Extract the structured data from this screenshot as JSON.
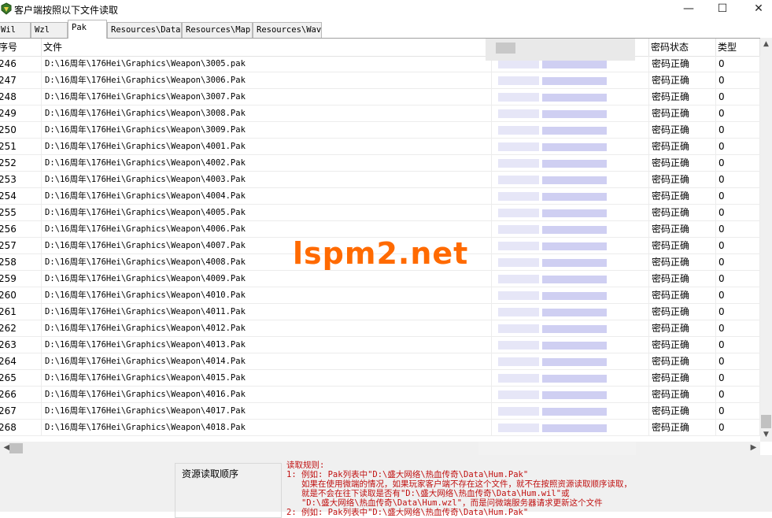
{
  "window": {
    "title": "客户端按照以下文件读取",
    "controls": {
      "minimize": "—",
      "maximize": "☐",
      "close": "✕"
    }
  },
  "tabs": [
    {
      "label": "Wil",
      "active": false
    },
    {
      "label": "Wzl",
      "active": false
    },
    {
      "label": "Pak",
      "active": true
    },
    {
      "label": "Resources\\Data",
      "active": false
    },
    {
      "label": "Resources\\Map",
      "active": false
    },
    {
      "label": "Resources\\Wav",
      "active": false
    }
  ],
  "list": {
    "columns": {
      "index": "序号",
      "file": "文件",
      "status": "密码状态",
      "type": "类型"
    },
    "rows": [
      {
        "index": "246",
        "file": "D:\\16周年\\176Hei\\Graphics\\Weapon\\3005.pak",
        "status": "密码正确",
        "type": "0"
      },
      {
        "index": "247",
        "file": "D:\\16周年\\176Hei\\Graphics\\Weapon\\3006.Pak",
        "status": "密码正确",
        "type": "0"
      },
      {
        "index": "248",
        "file": "D:\\16周年\\176Hei\\Graphics\\Weapon\\3007.Pak",
        "status": "密码正确",
        "type": "0"
      },
      {
        "index": "249",
        "file": "D:\\16周年\\176Hei\\Graphics\\Weapon\\3008.Pak",
        "status": "密码正确",
        "type": "0"
      },
      {
        "index": "250",
        "file": "D:\\16周年\\176Hei\\Graphics\\Weapon\\3009.Pak",
        "status": "密码正确",
        "type": "0"
      },
      {
        "index": "251",
        "file": "D:\\16周年\\176Hei\\Graphics\\Weapon\\4001.Pak",
        "status": "密码正确",
        "type": "0"
      },
      {
        "index": "252",
        "file": "D:\\16周年\\176Hei\\Graphics\\Weapon\\4002.Pak",
        "status": "密码正确",
        "type": "0"
      },
      {
        "index": "253",
        "file": "D:\\16周年\\176Hei\\Graphics\\Weapon\\4003.Pak",
        "status": "密码正确",
        "type": "0"
      },
      {
        "index": "254",
        "file": "D:\\16周年\\176Hei\\Graphics\\Weapon\\4004.Pak",
        "status": "密码正确",
        "type": "0"
      },
      {
        "index": "255",
        "file": "D:\\16周年\\176Hei\\Graphics\\Weapon\\4005.Pak",
        "status": "密码正确",
        "type": "0"
      },
      {
        "index": "256",
        "file": "D:\\16周年\\176Hei\\Graphics\\Weapon\\4006.Pak",
        "status": "密码正确",
        "type": "0"
      },
      {
        "index": "257",
        "file": "D:\\16周年\\176Hei\\Graphics\\Weapon\\4007.Pak",
        "status": "密码正确",
        "type": "0"
      },
      {
        "index": "258",
        "file": "D:\\16周年\\176Hei\\Graphics\\Weapon\\4008.Pak",
        "status": "密码正确",
        "type": "0"
      },
      {
        "index": "259",
        "file": "D:\\16周年\\176Hei\\Graphics\\Weapon\\4009.Pak",
        "status": "密码正确",
        "type": "0"
      },
      {
        "index": "260",
        "file": "D:\\16周年\\176Hei\\Graphics\\Weapon\\4010.Pak",
        "status": "密码正确",
        "type": "0"
      },
      {
        "index": "261",
        "file": "D:\\16周年\\176Hei\\Graphics\\Weapon\\4011.Pak",
        "status": "密码正确",
        "type": "0"
      },
      {
        "index": "262",
        "file": "D:\\16周年\\176Hei\\Graphics\\Weapon\\4012.Pak",
        "status": "密码正确",
        "type": "0"
      },
      {
        "index": "263",
        "file": "D:\\16周年\\176Hei\\Graphics\\Weapon\\4013.Pak",
        "status": "密码正确",
        "type": "0"
      },
      {
        "index": "264",
        "file": "D:\\16周年\\176Hei\\Graphics\\Weapon\\4014.Pak",
        "status": "密码正确",
        "type": "0"
      },
      {
        "index": "265",
        "file": "D:\\16周年\\176Hei\\Graphics\\Weapon\\4015.Pak",
        "status": "密码正确",
        "type": "0"
      },
      {
        "index": "266",
        "file": "D:\\16周年\\176Hei\\Graphics\\Weapon\\4016.Pak",
        "status": "密码正确",
        "type": "0"
      },
      {
        "index": "267",
        "file": "D:\\16周年\\176Hei\\Graphics\\Weapon\\4017.Pak",
        "status": "密码正确",
        "type": "0"
      },
      {
        "index": "268",
        "file": "D:\\16周年\\176Hei\\Graphics\\Weapon\\4018.Pak",
        "status": "密码正确",
        "type": "0"
      }
    ]
  },
  "bottom_panel": {
    "group_label": "资源读取顺序",
    "rules_lines": [
      "读取规则:",
      "1: 例如: Pak列表中\"D:\\盛大网络\\热血传奇\\Data\\Hum.Pak\"",
      "   如果在使用微端的情况，如果玩家客户端不存在这个文件，就不在按照资源读取顺序读取，",
      "   就是不会在往下读取是否有\"D:\\盛大网络\\热血传奇\\Data\\Hum.wil\"或",
      "   \"D:\\盛大网络\\热血传奇\\Data\\Hum.wzl\"，而是问微端服务器请求更新这个文件",
      "2: 例如: Pak列表中\"D:\\盛大网络\\热血传奇\\Data\\Hum.Pak\""
    ]
  },
  "watermark": "lspm2.net",
  "colors": {
    "rules_text": "#c01010",
    "watermark": "#ff6a00",
    "panel_bg": "#f0f0f0"
  }
}
